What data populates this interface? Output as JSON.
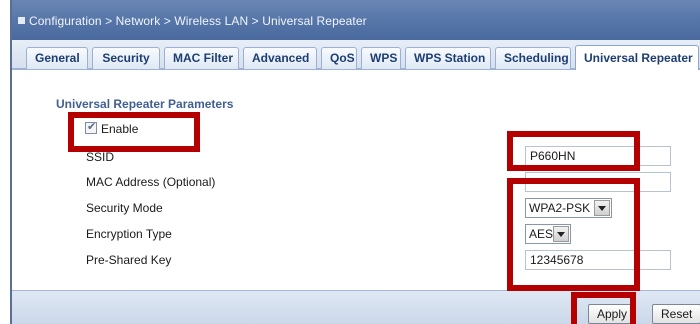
{
  "breadcrumb": "Configuration > Network > Wireless LAN > Universal Repeater",
  "tabs": [
    {
      "label": "General",
      "active": false
    },
    {
      "label": "Security",
      "active": false
    },
    {
      "label": "MAC Filter",
      "active": false
    },
    {
      "label": "Advanced",
      "active": false
    },
    {
      "label": "QoS",
      "active": false
    },
    {
      "label": "WPS",
      "active": false
    },
    {
      "label": "WPS Station",
      "active": false
    },
    {
      "label": "Scheduling",
      "active": false
    },
    {
      "label": "Universal Repeater",
      "active": true
    }
  ],
  "section": {
    "title": "Universal Repeater Parameters",
    "enable_label": "Enable",
    "enable_checked": true,
    "ssid_label": "SSID",
    "ssid_value": "P660HN",
    "mac_label": "MAC Address (Optional)",
    "mac_value": "",
    "security_mode_label": "Security Mode",
    "security_mode_value": "WPA2-PSK",
    "encryption_type_label": "Encryption Type",
    "encryption_type_value": "AES",
    "psk_label": "Pre-Shared Key",
    "psk_value": "12345678"
  },
  "buttons": {
    "apply": "Apply",
    "reset": "Reset"
  },
  "colors": {
    "highlight": "#b40000",
    "title_bar": "#5575a8",
    "section_title": "#415f91"
  }
}
